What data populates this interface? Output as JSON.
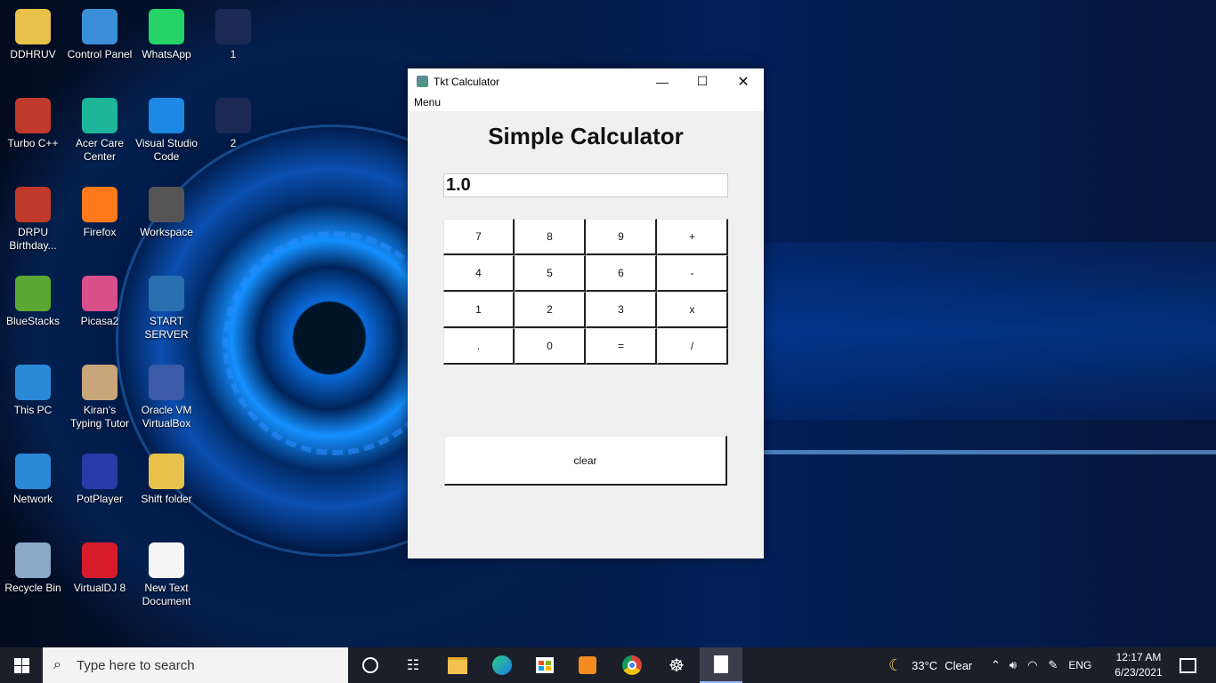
{
  "desktop": {
    "icons": [
      {
        "label": "DDHRUV",
        "icon": "folder-icon"
      },
      {
        "label": "Control Panel",
        "icon": "control-panel-icon"
      },
      {
        "label": "WhatsApp",
        "icon": "whatsapp-icon"
      },
      {
        "label": "1",
        "icon": "file-icon"
      },
      {
        "label": "Turbo C++",
        "icon": "turbo-cpp-icon"
      },
      {
        "label": "Acer Care Center",
        "icon": "acer-care-icon"
      },
      {
        "label": "Visual Studio Code",
        "icon": "vscode-icon"
      },
      {
        "label": "2",
        "icon": "file-icon"
      },
      {
        "label": "DRPU Birthday...",
        "icon": "drpu-icon"
      },
      {
        "label": "Firefox",
        "icon": "firefox-icon"
      },
      {
        "label": "Workspace",
        "icon": "workspace-icon"
      },
      {
        "label": "BlueStacks",
        "icon": "bluestacks-icon"
      },
      {
        "label": "Picasa2",
        "icon": "picasa-icon"
      },
      {
        "label": "START SERVER",
        "icon": "power-icon"
      },
      {
        "label": "This PC",
        "icon": "this-pc-icon"
      },
      {
        "label": "Kiran's Typing Tutor",
        "icon": "typing-tutor-icon"
      },
      {
        "label": "Oracle VM VirtualBox",
        "icon": "virtualbox-icon"
      },
      {
        "label": "Network",
        "icon": "network-icon"
      },
      {
        "label": "PotPlayer",
        "icon": "potplayer-icon"
      },
      {
        "label": "Shift folder",
        "icon": "folder-icon"
      },
      {
        "label": "Recycle Bin",
        "icon": "recycle-bin-icon"
      },
      {
        "label": "VirtualDJ 8",
        "icon": "virtualdj-icon"
      },
      {
        "label": "New Text Document",
        "icon": "text-document-icon"
      }
    ]
  },
  "window": {
    "title": "Tkt Calculator",
    "menu_label": "Menu",
    "heading": "Simple Calculator",
    "display_value": "1.0",
    "keys": [
      "7",
      "8",
      "9",
      "+",
      "4",
      "5",
      "6",
      "-",
      "1",
      "2",
      "3",
      "x",
      ".",
      "0",
      "=",
      "/"
    ],
    "clear_label": "clear"
  },
  "taskbar": {
    "search_placeholder": "Type here to search",
    "weather_temp": "33°C",
    "weather_text": "Clear",
    "language": "ENG",
    "time": "12:17 AM",
    "date": "6/23/2021"
  }
}
